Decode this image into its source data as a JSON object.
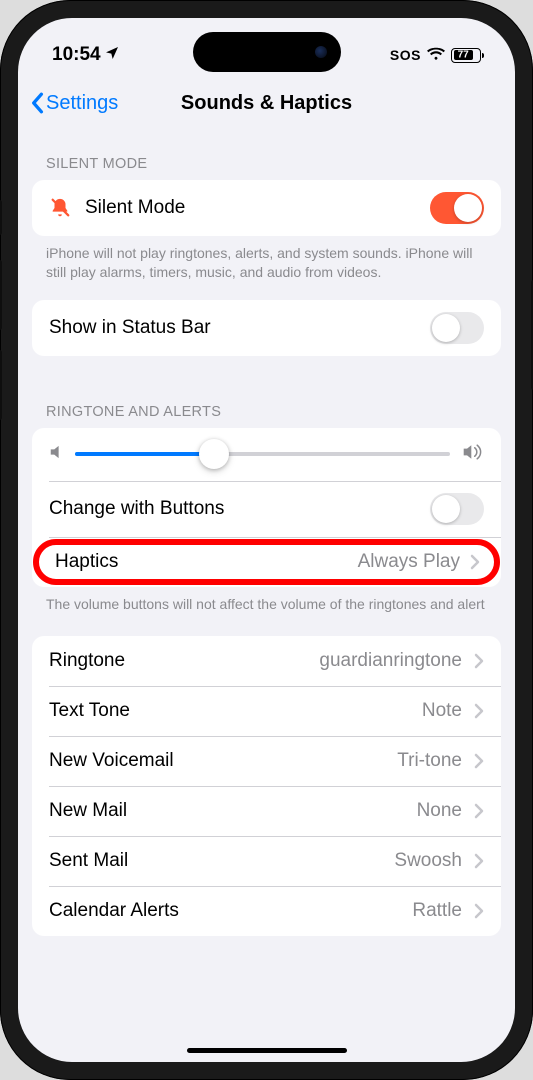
{
  "status": {
    "time": "10:54",
    "sos": "SOS",
    "battery": "77"
  },
  "nav": {
    "back": "Settings",
    "title": "Sounds & Haptics"
  },
  "silent_mode": {
    "header": "SILENT MODE",
    "label": "Silent Mode",
    "on": true,
    "footer": "iPhone will not play ringtones, alerts, and system sounds. iPhone will still play alarms, timers, music, and audio from videos."
  },
  "status_bar_toggle": {
    "label": "Show in Status Bar",
    "on": false
  },
  "ringtone_alerts": {
    "header": "RINGTONE AND ALERTS",
    "volume_percent": 37,
    "change_with_buttons": {
      "label": "Change with Buttons",
      "on": false
    },
    "haptics": {
      "label": "Haptics",
      "value": "Always Play"
    },
    "footer": "The volume buttons will not affect the volume of the ringtones and alert"
  },
  "sounds": {
    "items": [
      {
        "label": "Ringtone",
        "value": "guardianringtone"
      },
      {
        "label": "Text Tone",
        "value": "Note"
      },
      {
        "label": "New Voicemail",
        "value": "Tri-tone"
      },
      {
        "label": "New Mail",
        "value": "None"
      },
      {
        "label": "Sent Mail",
        "value": "Swoosh"
      },
      {
        "label": "Calendar Alerts",
        "value": "Rattle"
      }
    ]
  }
}
